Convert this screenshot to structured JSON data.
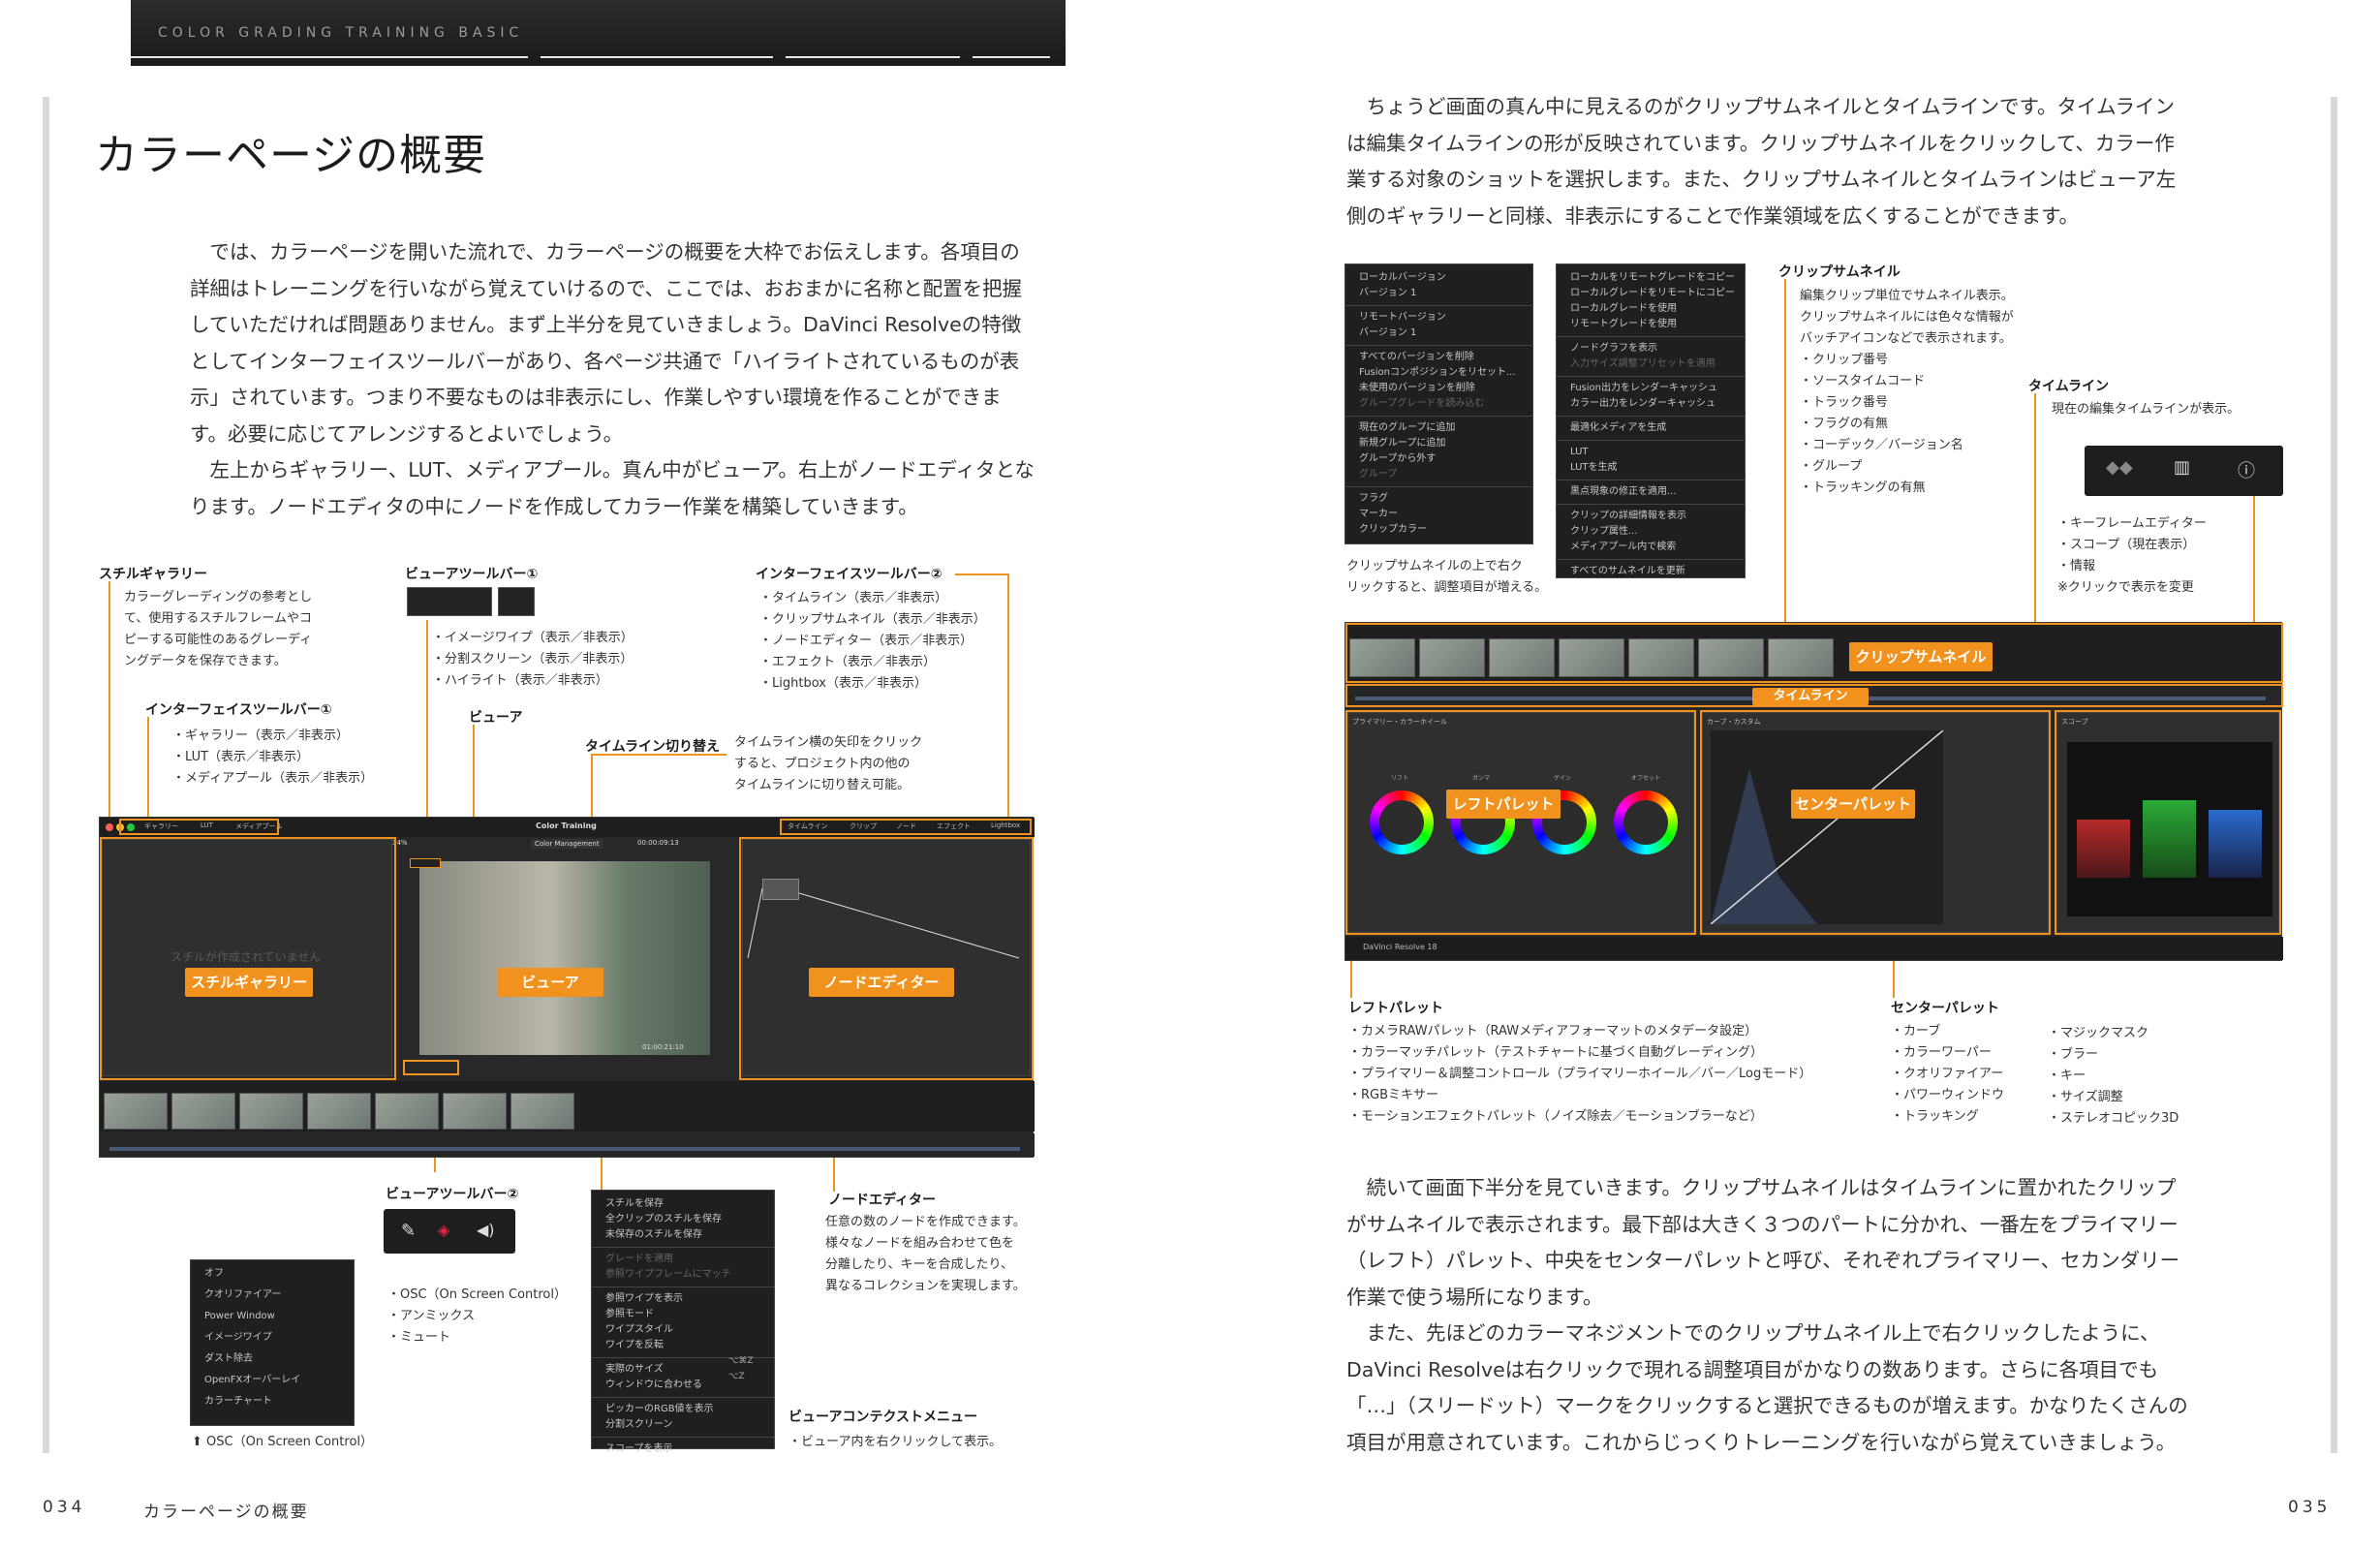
{
  "header": {
    "title": "COLOR GRADING TRAINING BASIC"
  },
  "left": {
    "heading": "カラーページの概要",
    "body": [
      "では、カラーページを開いた流れで、カラーページの概要を大枠でお伝えします。各項目の詳細はトレーニングを行いながら覚えていけるので、ここでは、おおまかに名称と配置を把握していただければ問題ありません。まず上半分を見ていきましょう。DaVinci Resolveの特徴としてインターフェイスツールバーがあり、各ページ共通で「ハイライトされているものが表示」されています。つまり不要なものは非表示にし、作業しやすい環境を作ることができます。必要に応じてアレンジするとよいでしょう。",
      "左上からギャラリー、LUT、メディアプール。真ん中がビューア。右上がノードエディタとなります。ノードエディタの中にノードを作成してカラー作業を構築していきます。"
    ],
    "callouts": {
      "still_gallery": {
        "title": "スチルギャラリー",
        "desc": [
          "カラーグレーディングの参考とし",
          "て、使用するスチルフレームやコ",
          "ピーする可能性のあるグレーディ",
          "ングデータを保存できます。"
        ]
      },
      "interface_toolbar_1": {
        "title": "インターフェイスツールバー①",
        "items": [
          "・ギャラリー（表示／非表示）",
          "・LUT（表示／非表示）",
          "・メディアプール（表示／非表示）"
        ]
      },
      "viewer_toolbar_1": {
        "title": "ビューアツールバー①",
        "items": [
          "・イメージワイプ（表示／非表示）",
          "・分割スクリーン（表示／非表示）",
          "・ハイライト（表示／非表示）"
        ]
      },
      "viewer": {
        "title": "ビューア"
      },
      "timeline_switch": {
        "title": "タイムライン切り替え",
        "desc": [
          "タイムライン横の矢印をクリック",
          "すると、プロジェクト内の他の",
          "タイムラインに切り替え可能。"
        ]
      },
      "interface_toolbar_2": {
        "title": "インターフェイスツールバー②",
        "items": [
          "・タイムライン（表示／非表示）",
          "・クリップサムネイル（表示／非表示）",
          "・ノードエディター（表示／非表示）",
          "・エフェクト（表示／非表示）",
          "・Lightbox（表示／非表示）"
        ]
      },
      "viewer_toolbar_2": {
        "title": "ビューアツールバー②",
        "items": [
          "・OSC（On Screen Control）",
          "・アンミックス",
          "・ミュート"
        ]
      },
      "node_editor": {
        "title": "ノードエディター",
        "desc": [
          "任意の数のノードを作成できます。",
          "様々なノードを組み合わせて色を",
          "分離したり、キーを合成したり、",
          "異なるコレクションを実現します。"
        ]
      },
      "viewer_context": {
        "title": "ビューアコンテクストメニュー",
        "desc": "・ビューア内を右クリックして表示。"
      },
      "osc_caption": "⬆ OSC（On Screen Control）"
    },
    "screen": {
      "title": "Color Training",
      "cm": "Color Management",
      "tc": "00:00:09:13",
      "tc2": "01:00:21:10",
      "zoom": "34%",
      "overlays": {
        "gallery": "スチルギャラリー",
        "viewer": "ビューア",
        "node": "ノードエディター"
      },
      "empty": "スチルが作成されていません",
      "toolbar_left": [
        "ギャラリー",
        "LUT",
        "メディアプール"
      ],
      "toolbar_right": [
        "タイムライン",
        "クリップ",
        "ノード",
        "エフェクト",
        "Lightbox"
      ]
    },
    "osc_menu": [
      "オフ",
      "クオリファイアー",
      "Power Window",
      "イメージワイプ",
      "ダスト除去",
      "OpenFXオーバーレイ",
      "カラーチャート"
    ],
    "context_menu": [
      "スチルを保存",
      "全クリップのスチルを保存",
      "未保存のスチルを保存",
      "グレードを適用",
      "参照ワイプフレームにマッチ",
      "参照ワイプを表示",
      "参照モード",
      "ワイプスタイル",
      "ワイプを反転",
      "実際のサイズ",
      "ウィンドウに合わせる",
      "ピッカーのRGB値を表示",
      "分割スクリーン",
      "スコープを表示"
    ],
    "context_shortcuts": [
      "⌥⌘Z",
      "⌥Z"
    ],
    "footer": {
      "page": "034",
      "title": "カラーページの概要"
    }
  },
  "right": {
    "intro": "ちょうど画面の真ん中に見えるのがクリップサムネイルとタイムラインです。タイムラインは編集タイムラインの形が反映されています。クリップサムネイルをクリックして、カラー作業する対象のショットを選択します。また、クリップサムネイルとタイムラインはビューア左側のギャラリーと同様、非表示にすることで作業領域を広くすることができます。",
    "menu1": [
      "ローカルバージョン",
      "バージョン 1",
      "リモートバージョン",
      "バージョン 1",
      "すべてのバージョンを削除",
      "Fusionコンポジションをリセット...",
      "未使用のバージョンを削除",
      "グループグレードを読み込む",
      "現在のグループに追加",
      "新規グループに追加",
      "グループから外す",
      "グループ",
      "フラグ",
      "マーカー",
      "クリップカラー"
    ],
    "menu2": [
      "ローカルをリモートグレードをコピー",
      "ローカルグレードをリモートにコピー",
      "ローカルグレードを使用",
      "リモートグレードを使用",
      "ノードグラフを表示",
      "入力サイズ調整プリセットを適用",
      "Fusion出力をレンダーキャッシュ",
      "カラー出力をレンダーキャッシュ",
      "最適化メディアを生成",
      "LUT",
      "LUTを生成",
      "黒点現象の修正を適用...",
      "クリップの詳細情報を表示",
      "クリップ属性...",
      "メディアプール内で検索",
      "すべてのサムネイルを更新"
    ],
    "menu_caption": [
      "クリップサムネイルの上で右ク",
      "リックすると、調整項目が増える。"
    ],
    "clip_thumb": {
      "title": "クリップサムネイル",
      "desc": [
        "編集クリップ単位でサムネイル表示。",
        "クリップサムネイルには色々な情報が",
        "バッチアイコンなどで表示されます。"
      ],
      "items": [
        "・クリップ番号",
        "・ソースタイムコード",
        "・トラック番号",
        "・フラグの有無",
        "・コーデック／バージョン名",
        "・グループ",
        "・トラッキングの有無"
      ]
    },
    "timeline": {
      "title": "タイムライン",
      "desc": "現在の編集タイムラインが表示。"
    },
    "toolbar_items": [
      "・キーフレームエディター",
      "・スコープ（現在表示）",
      "・情報",
      "※クリックで表示を変更"
    ],
    "overlays": {
      "clip": "クリップサムネイル",
      "timeline": "タイムライン",
      "left": "レフトパレット",
      "center": "センターパレット"
    },
    "palette_titles": {
      "primary": "プライマリー・カラーホイール",
      "curve": "カーブ・カスタム",
      "scope": "スコープ",
      "app": "DaVinci Resolve 18"
    },
    "wheel_labels": [
      "リフト",
      "ガンマ",
      "ゲイン",
      "オフセット"
    ],
    "left_palette": {
      "title": "レフトパレット",
      "items": [
        "・カメラRAWパレット（RAWメディアフォーマットのメタデータ設定）",
        "・カラーマッチパレット（テストチャートに基づく自動グレーディング）",
        "・プライマリー＆調整コントロール（プライマリーホイール／バー／Logモード）",
        "・RGBミキサー",
        "・モーションエフェクトパレット（ノイズ除去／モーションブラーなど）"
      ]
    },
    "center_palette": {
      "title": "センターパレット",
      "items_a": [
        "・カーブ",
        "・カラーワーパー",
        "・クオリファイアー",
        "・パワーウィンドウ",
        "・トラッキング"
      ],
      "items_b": [
        "・マジックマスク",
        "・ブラー",
        "・キー",
        "・サイズ調整",
        "・ステレオコピック3D"
      ]
    },
    "body": [
      "続いて画面下半分を見ていきます。クリップサムネイルはタイムラインに置かれたクリップがサムネイルで表示されます。最下部は大きく３つのパートに分かれ、一番左をプライマリー（レフト）パレット、中央をセンターパレットと呼び、それぞれプライマリー、セカンダリー作業で使う場所になります。",
      "また、先ほどのカラーマネジメントでのクリップサムネイル上で右クリックしたように、DaVinci Resolveは右クリックで現れる調整項目がかなりの数あります。さらに各項目でも「…」（スリードット）マークをクリックすると選択できるものが増えます。かなりたくさんの項目が用意されています。これからじっくりトレーニングを行いながら覚えていきましょう。"
    ],
    "footer": {
      "page": "035"
    }
  }
}
